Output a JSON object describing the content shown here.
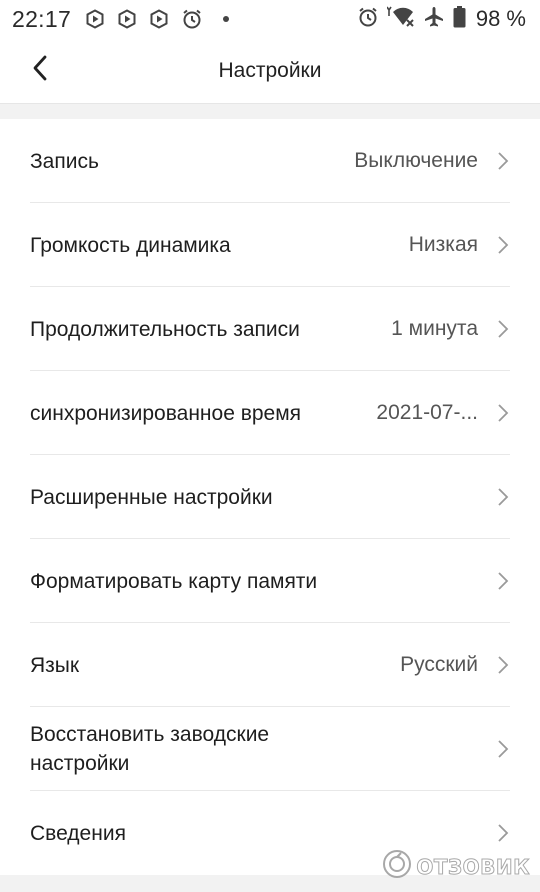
{
  "status_bar": {
    "time": "22:17",
    "battery": "98 %",
    "left_icons": [
      "play-hexagon-icon",
      "play-hexagon-icon",
      "play-hexagon-icon",
      "alarm-icon",
      "dot-icon"
    ],
    "right_icons": [
      "alarm-icon",
      "wifi-data-icon",
      "airplane-icon",
      "battery-icon"
    ]
  },
  "header": {
    "title": "Настройки",
    "back_icon": "chevron-left-icon"
  },
  "settings": [
    {
      "label": "Запись",
      "value": "Выключение"
    },
    {
      "label": "Громкость динамика",
      "value": "Низкая"
    },
    {
      "label": "Продолжительность записи",
      "value": "1 минута"
    },
    {
      "label": "синхронизированное время",
      "value": "2021-07-..."
    },
    {
      "label": "Расширенные настройки",
      "value": ""
    },
    {
      "label": "Форматировать карту памяти",
      "value": ""
    },
    {
      "label": "Язык",
      "value": "Русский"
    },
    {
      "label": "Восстановить заводские настройки",
      "value": ""
    },
    {
      "label": "Сведения",
      "value": ""
    }
  ],
  "watermark": {
    "text": "ОТЗОВИК"
  },
  "colors": {
    "page_background": "#f2f2f2",
    "surface": "#ffffff",
    "text_primary": "#1e1e1e",
    "text_secondary": "#555555",
    "divider": "#e8e8e8",
    "chevron": "#9a9a9a"
  }
}
